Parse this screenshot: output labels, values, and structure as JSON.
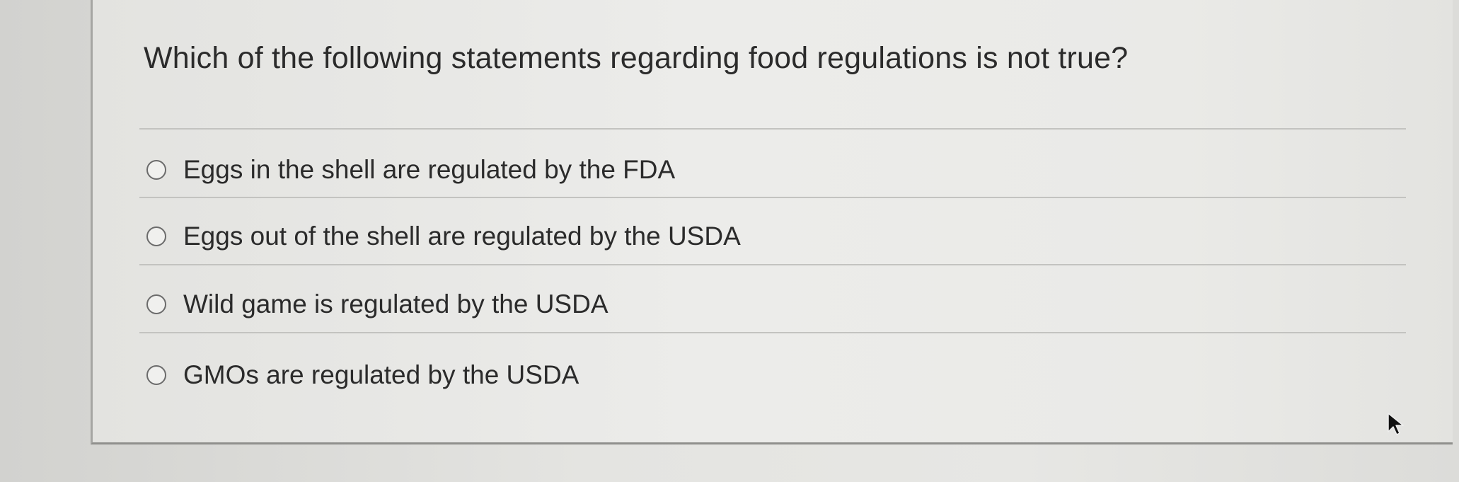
{
  "question": {
    "text": "Which of the following statements regarding food regulations is not true?"
  },
  "options": [
    {
      "label": "Eggs in the shell are regulated by the FDA",
      "selected": false
    },
    {
      "label": "Eggs out of the shell are regulated by the USDA",
      "selected": false
    },
    {
      "label": "Wild game is regulated by the USDA",
      "selected": false
    },
    {
      "label": "GMOs are regulated by the USDA",
      "selected": false
    }
  ],
  "icons": {
    "radio": "radio-button-icon",
    "cursor": "mouse-pointer-icon"
  }
}
